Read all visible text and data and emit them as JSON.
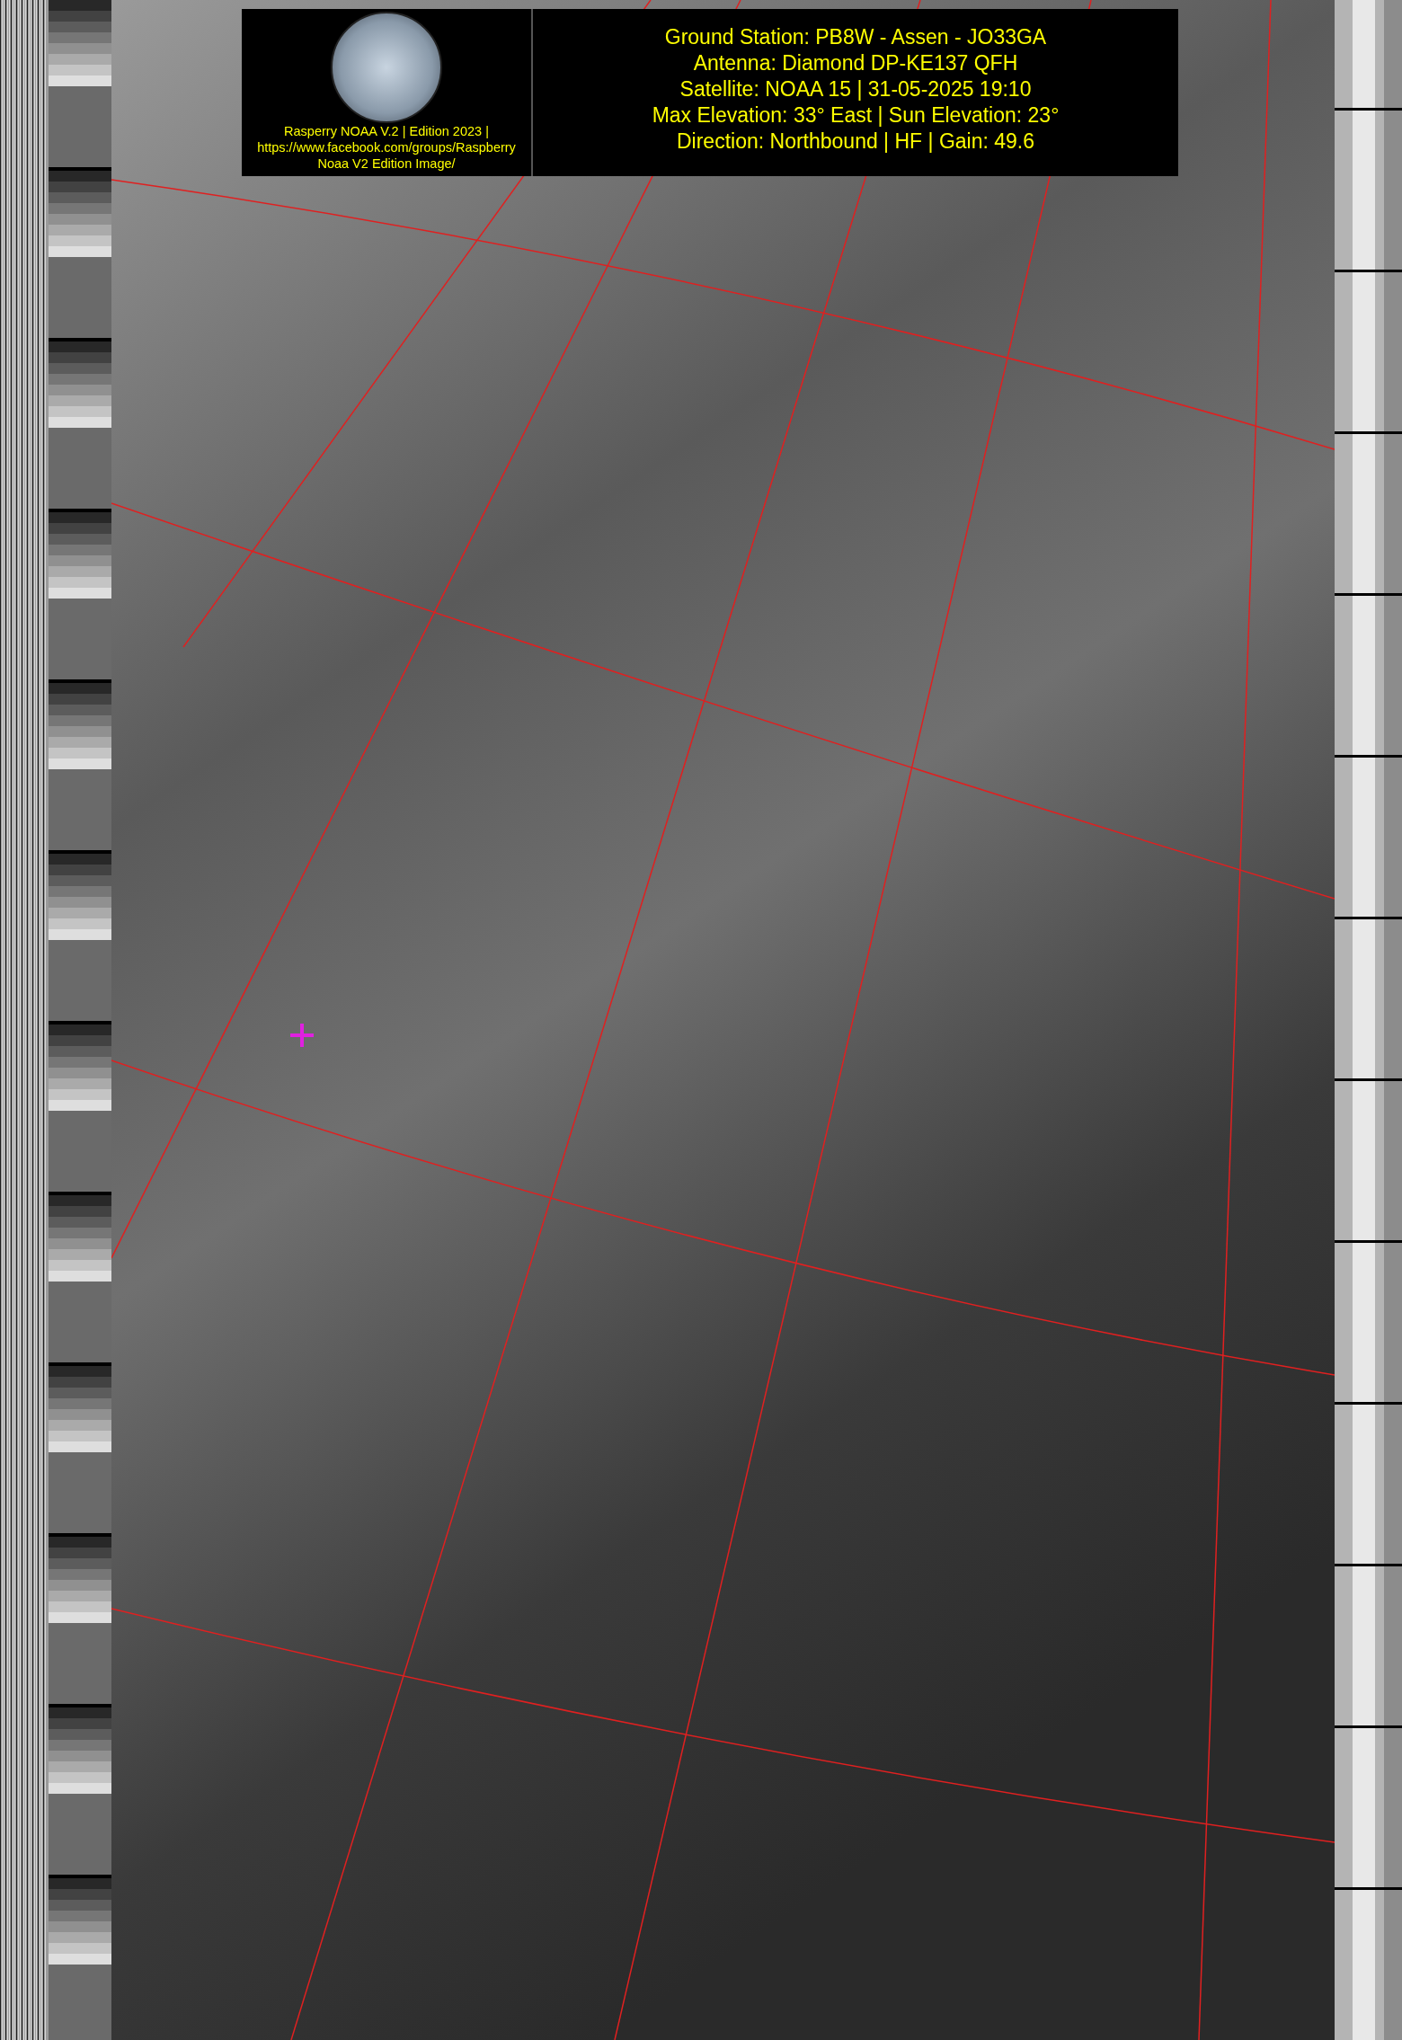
{
  "header": {
    "logo_caption": [
      "Rasperry NOAA V.2 | Edition 2023 |",
      "https://www.facebook.com/groups/Raspberry",
      "Noaa V2 Edition Image/"
    ],
    "info_lines": [
      "Ground Station: PB8W - Assen - JO33GA",
      "Antenna: Diamond DP-KE137 QFH",
      "Satellite: NOAA 15 | 31-05-2025 19:10",
      "Max Elevation: 33° East | Sun Elevation: 23°",
      "Direction: Northbound | HF | Gain: 49.6"
    ]
  }
}
